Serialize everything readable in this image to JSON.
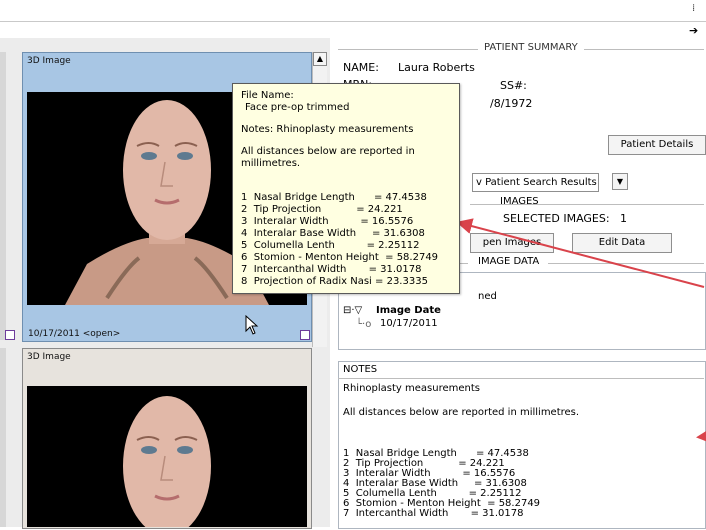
{
  "patient_summary": {
    "section_title": "PATIENT SUMMARY",
    "name_label": "NAME:",
    "name_value": "Laura Roberts",
    "mrn_label_partial": "MRN:",
    "ss_label": "SS#:",
    "dob_partial": "/8/1972",
    "details_button": "Patient Details"
  },
  "search": {
    "select_value": "v Patient Search Results"
  },
  "images": {
    "title": "IMAGES",
    "selected_label": "SELECTED IMAGES:",
    "selected_count": "1",
    "open_button": "pen Images",
    "edit_button": "Edit Data",
    "image_data_title": "IMAGE DATA"
  },
  "tree": {
    "name_partial": "ned",
    "date_node": "Image Date",
    "date_value": "10/17/2011"
  },
  "cards": [
    {
      "label": "3D Image",
      "date_text": "10/17/2011 <open>"
    },
    {
      "label": "3D Image"
    }
  ],
  "tooltip": {
    "file_name_label": "File Name:",
    "file_name_value": "Face pre-op trimmed",
    "notes_line": "Notes: Rhinoplasty measurements",
    "distances_line": "All distances below are reported in millimetres.",
    "measurements": [
      "1  Nasal Bridge Length      = 47.4538",
      "2  Tip Projection           = 24.221",
      "3  Interalar Width          = 16.5576",
      "4  Interalar Base Width     = 31.6308",
      "5  Columella Lenth          = 2.25112",
      "6  Stomion - Menton Height  = 58.2749",
      "7  Intercanthal Width       = 31.0178",
      "8  Projection of Radix Nasi = 23.3335"
    ]
  },
  "notes": {
    "title": "NOTES",
    "line1": "Rhinoplasty measurements",
    "line2": "All distances below are reported in millimetres.",
    "measurements": [
      "1  Nasal Bridge Length      = 47.4538",
      "2  Tip Projection           = 24.221",
      "3  Interalar Width          = 16.5576",
      "4  Interalar Base Width     = 31.6308",
      "5  Columella Lenth          = 2.25112",
      "6  Stomion - Menton Height  = 58.2749",
      "7  Intercanthal Width       = 31.0178"
    ]
  },
  "colors": {
    "annotation_arrow": "#d9434b",
    "card_selected": "#a8c6e4",
    "tooltip_bg": "#ffffe1"
  }
}
